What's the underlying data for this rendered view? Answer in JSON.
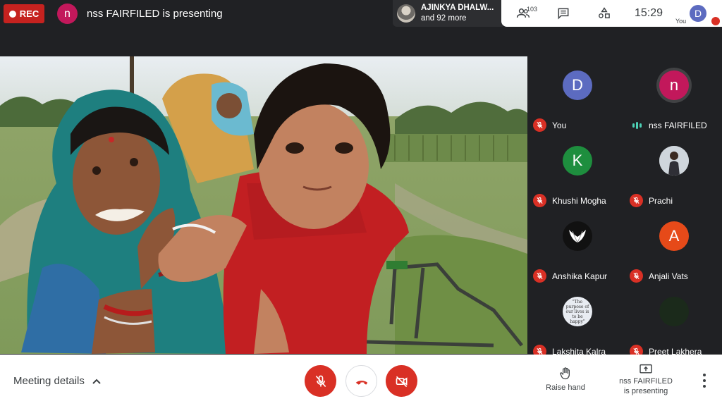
{
  "top_bar": {
    "rec_label": "REC",
    "presenter_initial": "n",
    "presenting_text": "nss FAIRFILED is presenting",
    "join_line1": "AJINKYA DHALW...",
    "join_line2": "and 92 more",
    "people_count": "103",
    "time": "15:29",
    "you_initial": "D",
    "you_label": "You"
  },
  "participants": [
    {
      "name": "You",
      "initial": "D",
      "color": "#5c6bc0",
      "muted": true
    },
    {
      "name": "nss FAIRFILED",
      "initial": "n",
      "color": "#c2185b",
      "muted": false,
      "speaking": true
    },
    {
      "name": "Khushi Mogha",
      "initial": "K",
      "color": "#1e8e3e",
      "muted": true
    },
    {
      "name": "Prachi",
      "initial": "",
      "color": "#d8dbe0",
      "muted": true,
      "photo": true
    },
    {
      "name": "Anshika Kapur",
      "initial": "",
      "color": "#111111",
      "muted": true,
      "icon": "wings-icon"
    },
    {
      "name": "Anjali Vats",
      "initial": "A",
      "color": "#e64a19",
      "muted": true
    },
    {
      "name": "Lakshita Kalra",
      "initial": "",
      "color": "#e8ecf2",
      "muted": true,
      "quote": "\"The purpose of our lives is to be happy\""
    },
    {
      "name": "Preet Lakhera",
      "initial": "",
      "color": "#1b2a1b",
      "muted": true
    }
  ],
  "bottom_bar": {
    "meeting_details": "Meeting details",
    "raise_hand": "Raise hand",
    "present_line1": "nss FAIRFILED",
    "present_line2": "is presenting"
  },
  "colors": {
    "accent_red": "#d93025",
    "background": "#202124",
    "speaking": "#4dd0b5"
  }
}
